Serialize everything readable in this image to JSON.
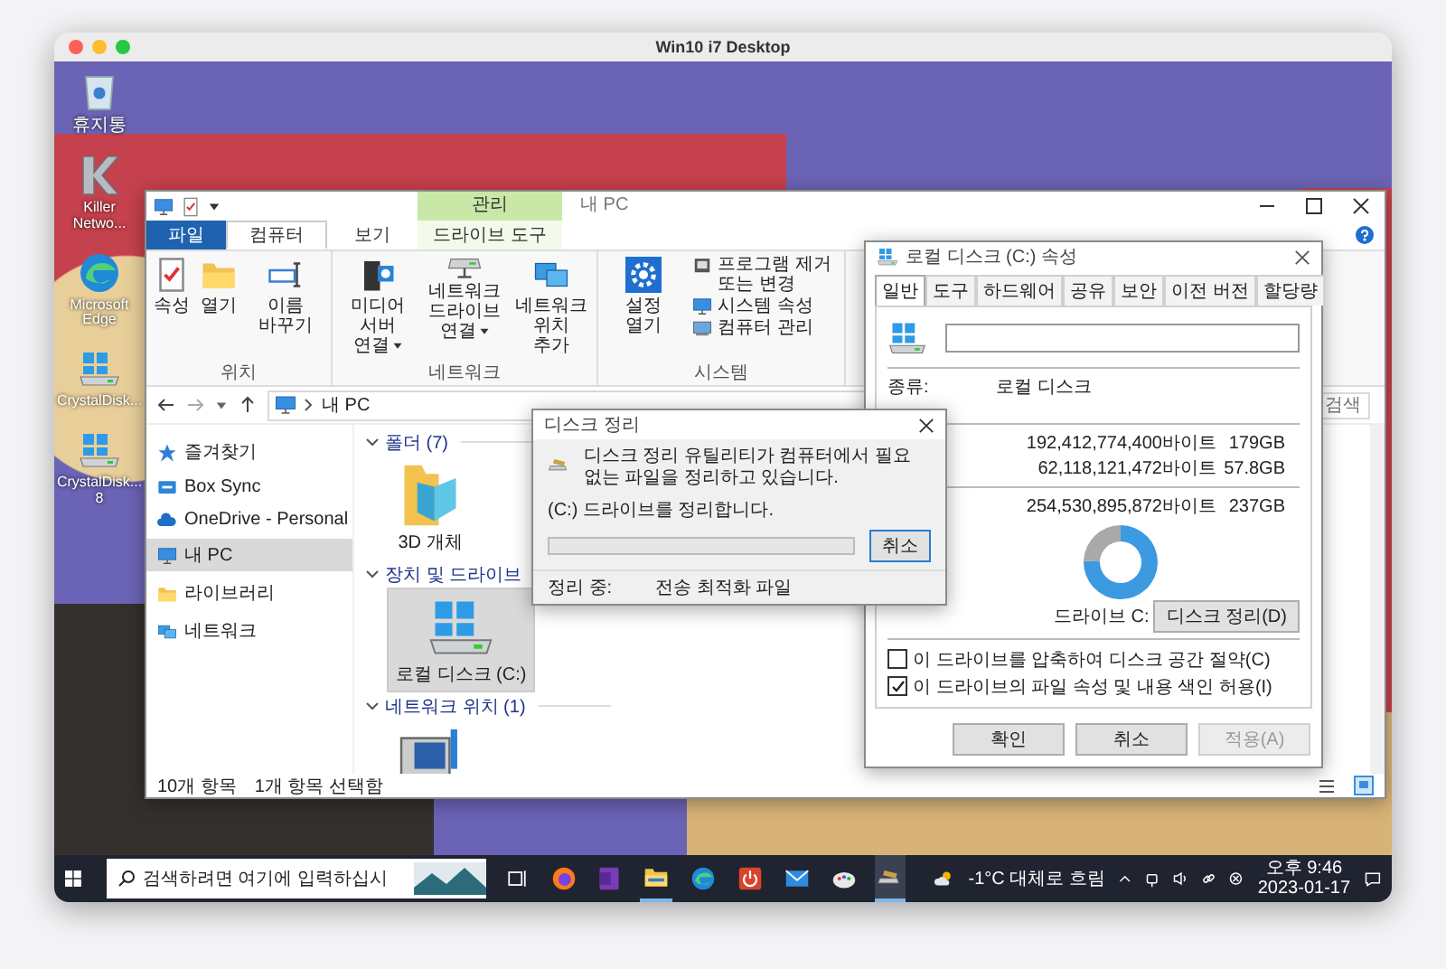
{
  "mac_window": {
    "title": "Win10 i7 Desktop"
  },
  "desktop_icons": [
    {
      "label": "휴지통",
      "kind": "recycle-bin"
    },
    {
      "label": "Killer Netwo...",
      "kind": "killer"
    },
    {
      "label": "Microsoft Edge",
      "kind": "edge"
    },
    {
      "label": "CrystalDisk...",
      "kind": "crystal-info"
    },
    {
      "label": "CrystalDisk... 8",
      "kind": "crystal-mark"
    }
  ],
  "explorer": {
    "title": "내 PC",
    "context_header": "관리",
    "tabs": [
      {
        "label": "파일",
        "kind": "file",
        "selected": false
      },
      {
        "label": "컴퓨터",
        "kind": "normal",
        "selected": true
      },
      {
        "label": "보기",
        "kind": "normal",
        "selected": false
      },
      {
        "label": "드라이브 도구",
        "kind": "context",
        "selected": false
      }
    ],
    "ribbon_groups": [
      {
        "label": "위치",
        "buttons": [
          {
            "label": "속성",
            "kind": "properties",
            "dropdown": false
          },
          {
            "label": "열기",
            "kind": "open",
            "dropdown": false
          },
          {
            "label": "이름 바꾸기",
            "kind": "rename",
            "dropdown": false
          }
        ]
      },
      {
        "label": "네트워크",
        "buttons": [
          {
            "label": "미디어 서버 연결",
            "kind": "media",
            "dropdown": true
          },
          {
            "label": "네트워크 드라이브 연결",
            "kind": "netdrive",
            "dropdown": true
          },
          {
            "label": "네트워크 위치 추가",
            "kind": "netloc",
            "dropdown": false
          }
        ]
      },
      {
        "label": "시스템",
        "buttons": [
          {
            "label": "설정 열기",
            "kind": "settings",
            "dropdown": false
          }
        ],
        "small_buttons": [
          {
            "label": "프로그램 제거 또는 변경",
            "kind": "uninstall"
          },
          {
            "label": "시스템 속성",
            "kind": "sysprops"
          },
          {
            "label": "컴퓨터 관리",
            "kind": "compmgmt"
          }
        ]
      }
    ],
    "address": "내 PC",
    "search_placeholder": "검색",
    "nav_items": [
      {
        "label": "즐겨찾기",
        "kind": "star",
        "selected": false
      },
      {
        "label": "Box Sync",
        "kind": "box",
        "selected": false
      },
      {
        "label": "OneDrive - Personal",
        "kind": "cloud",
        "selected": false
      },
      {
        "label": "내 PC",
        "kind": "pc",
        "selected": true
      },
      {
        "label": "라이브러리",
        "kind": "library",
        "selected": false
      },
      {
        "label": "네트워크",
        "kind": "network",
        "selected": false
      }
    ],
    "sections": [
      {
        "title": "폴더 (7)",
        "items": [
          {
            "label": "3D 개체",
            "kind": "cube",
            "selected": false
          }
        ]
      },
      {
        "title": "장치 및 드라이브",
        "items": [
          {
            "label": "로컬 디스크 (C:)",
            "kind": "drive",
            "selected": true
          }
        ]
      },
      {
        "title": "네트워크 위치 (1)",
        "items": [
          {
            "kind": "media",
            "selected": false
          }
        ]
      }
    ],
    "status": [
      "10개 항목",
      "1개 항목 선택함"
    ]
  },
  "properties": {
    "title": "로컬 디스크 (C:) 속성",
    "tabs": [
      {
        "label": "일반",
        "selected": true
      },
      {
        "label": "도구",
        "selected": false
      },
      {
        "label": "하드웨어",
        "selected": false
      },
      {
        "label": "공유",
        "selected": false
      },
      {
        "label": "보안",
        "selected": false
      },
      {
        "label": "이전 버전",
        "selected": false
      },
      {
        "label": "할당량",
        "selected": false
      }
    ],
    "type_label": "종류:",
    "type_value": "로컬 디스크",
    "usage_rows": [
      {
        "bytes": "192,412,774,400바이트",
        "size": "179GB"
      },
      {
        "bytes": "62,118,121,472바이트",
        "size": "57.8GB"
      }
    ],
    "capacity_row": {
      "bytes": "254,530,895,872바이트",
      "size": "237GB"
    },
    "usage_chart": {
      "chart_data": {
        "type": "donut",
        "values": [
          75.6,
          24.4
        ]
      }
    },
    "drive_label": "드라이브 C:",
    "cleanup_button": "디스크 정리(D)",
    "checkboxes": [
      {
        "label": "이 드라이브를 압축하여 디스크 공간 절약(C)",
        "checked": false
      },
      {
        "label": "이 드라이브의 파일 속성 및 내용 색인 허용(I)",
        "checked": true
      }
    ],
    "buttons": [
      {
        "label": "확인",
        "disabled": false
      },
      {
        "label": "취소",
        "disabled": false
      },
      {
        "label": "적용(A)",
        "disabled": true
      }
    ]
  },
  "cleanup": {
    "title": "디스크 정리",
    "message": "디스크 정리 유틸리티가 컴퓨터에서 필요 없는 파일을 정리하고 있습니다.",
    "drive_status": "(C:) 드라이브를 정리합니다.",
    "progress": {
      "level": 0
    },
    "cancel": "취소",
    "current_label": "정리 중:",
    "current_item": "전송 최적화 파일"
  },
  "taskbar": {
    "search_placeholder": "검색하려면 여기에 입력하십시",
    "apps": [
      {
        "kind": "taskview",
        "open": false,
        "active": false
      },
      {
        "kind": "firefox",
        "open": false,
        "active": false
      },
      {
        "kind": "onenote",
        "open": false,
        "active": false
      },
      {
        "kind": "explorer",
        "open": true,
        "active": false
      },
      {
        "kind": "edge",
        "open": false,
        "active": false
      },
      {
        "kind": "power",
        "open": false,
        "active": false
      },
      {
        "kind": "mail",
        "open": false,
        "active": false
      },
      {
        "kind": "paint",
        "open": false,
        "active": false
      },
      {
        "kind": "cleanup",
        "open": true,
        "active": true
      }
    ],
    "weather": "-1°C 대체로 흐림",
    "time": "오후 9:46",
    "date": "2023-01-17"
  }
}
